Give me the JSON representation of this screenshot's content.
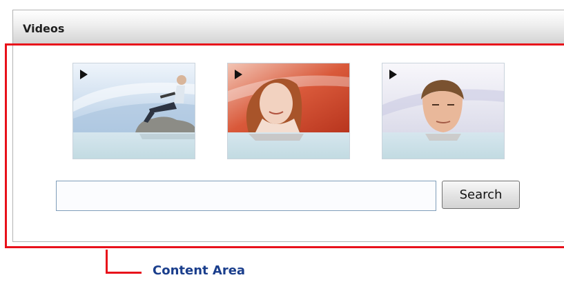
{
  "web_part": {
    "title": "Videos"
  },
  "videos": [
    {
      "subject": "person-with-laptop-on-rock",
      "icon": "play-icon"
    },
    {
      "subject": "smiling-woman",
      "icon": "play-icon"
    },
    {
      "subject": "man-portrait",
      "icon": "play-icon"
    }
  ],
  "search": {
    "value": "",
    "placeholder": "",
    "button_label": "Search"
  },
  "callout": {
    "label": "Content Area",
    "color": "#e8101a",
    "label_color": "#1a3e8c"
  }
}
